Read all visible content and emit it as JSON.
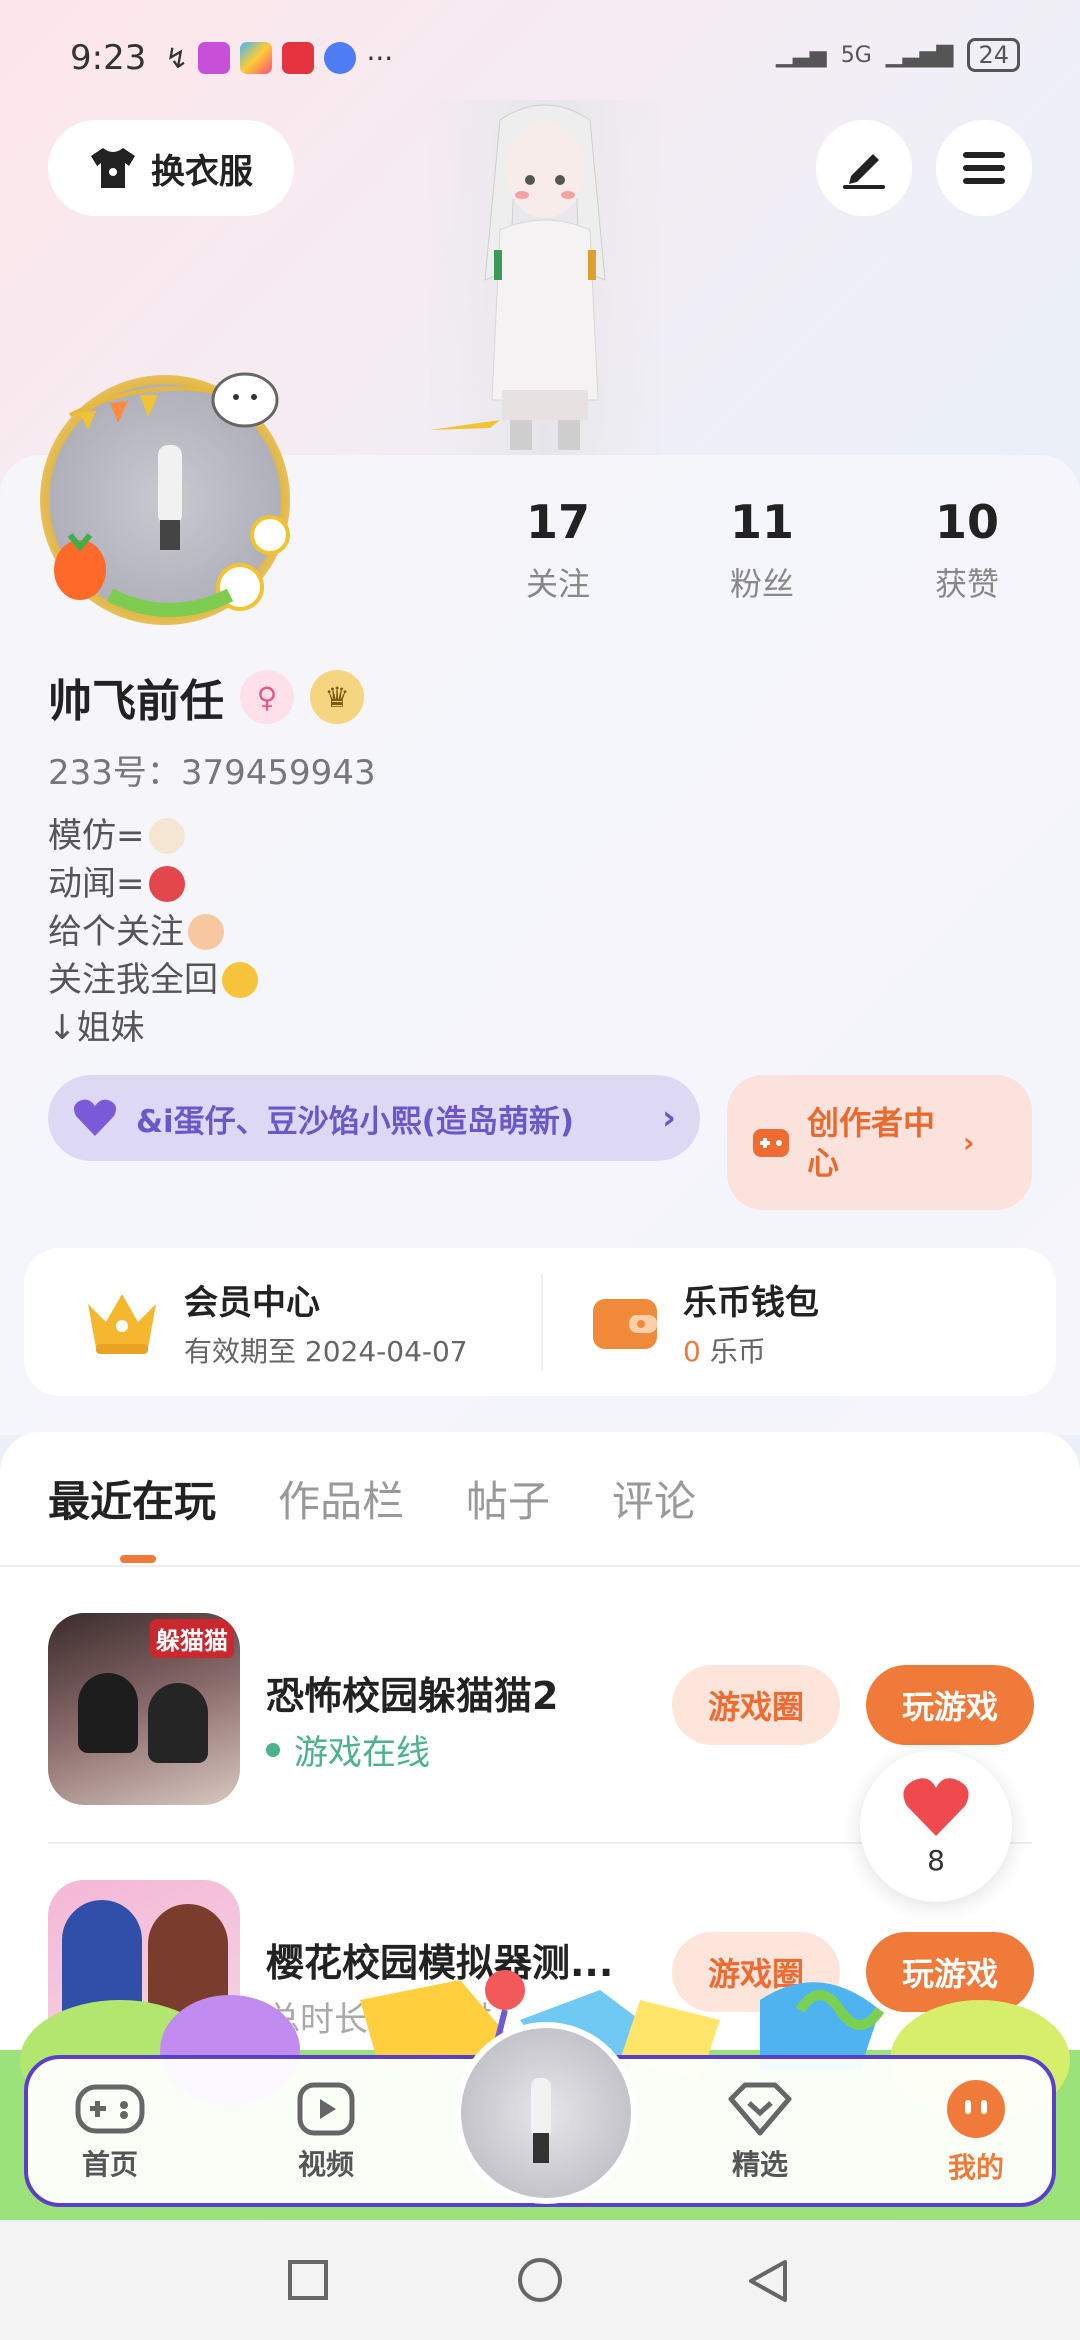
{
  "status_bar": {
    "time": "9:23",
    "network": "5G",
    "battery": "24"
  },
  "header": {
    "outfit_button": "换衣服"
  },
  "profile": {
    "stats": [
      {
        "num": "17",
        "label": "关注"
      },
      {
        "num": "11",
        "label": "粉丝"
      },
      {
        "num": "10",
        "label": "获赞"
      }
    ],
    "name": "帅飞前任",
    "uid": "233号：379459943",
    "bio": [
      "模仿=",
      "动闻=",
      "给个关注",
      "关注我全回",
      "↓姐妹"
    ],
    "friend_pill": "&i蛋仔、豆沙馅小熙(造岛萌新)",
    "creator_center": "创作者中心"
  },
  "vip": {
    "title": "会员中心",
    "sub": "有效期至 2024-04-07",
    "wallet_title": "乐币钱包",
    "wallet_amount": "0",
    "wallet_unit": "乐币"
  },
  "tabs": [
    "最近在玩",
    "作品栏",
    "帖子",
    "评论"
  ],
  "games": [
    {
      "name": "恐怖校园躲猫猫2",
      "status": "游戏在线",
      "circle": "游戏圈",
      "play": "玩游戏",
      "icon_text": "躲猫猫"
    },
    {
      "name": "樱花校园模拟器测...",
      "status": "总时长：4小时",
      "circle": "游戏圈",
      "play": "玩游戏"
    }
  ],
  "like": {
    "count": "8"
  },
  "nav": [
    {
      "label": "首页"
    },
    {
      "label": "视频"
    },
    {
      "label": "精选"
    },
    {
      "label": "我的"
    }
  ],
  "colors": {
    "accent": "#f07a3a",
    "purple": "#6b57c9",
    "green": "#4bb38a"
  }
}
